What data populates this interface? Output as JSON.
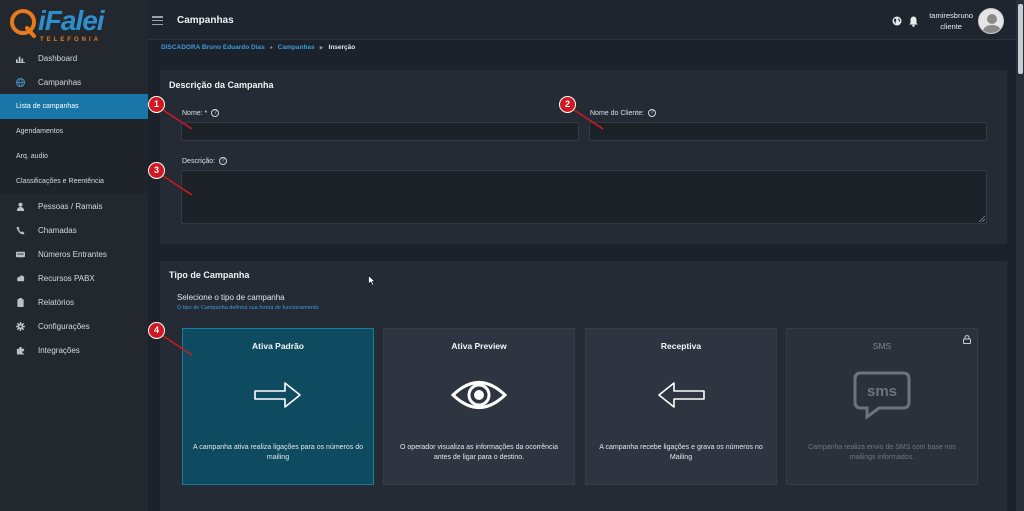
{
  "logo": {
    "name": "iFalei",
    "tagline": "TELEFONIA"
  },
  "sidebar": {
    "items": [
      {
        "label": "Dashboard",
        "icon": "chart-icon"
      },
      {
        "label": "Campanhas",
        "icon": "globe-icon"
      }
    ],
    "subitems": [
      {
        "label": "Lista de campanhas",
        "active": true
      },
      {
        "label": "Agendamentos"
      },
      {
        "label": "Arq. audio"
      },
      {
        "label": "Classificações e Reentência"
      }
    ],
    "more_items": [
      {
        "label": "Pessoas / Ramais",
        "icon": "user-icon"
      },
      {
        "label": "Chamadas",
        "icon": "phone-icon"
      },
      {
        "label": "Números Entrantes",
        "icon": "number-icon"
      },
      {
        "label": "Recursos PABX",
        "icon": "cloud-icon"
      },
      {
        "label": "Relatórios",
        "icon": "clipboard-icon"
      },
      {
        "label": "Configurações",
        "icon": "gear-icon"
      },
      {
        "label": "Integrações",
        "icon": "puzzle-icon"
      }
    ]
  },
  "header": {
    "title": "Campanhas",
    "user": "tamiresbruno",
    "role": "cliente"
  },
  "breadcrumb": [
    "DISCADORA Bruno Eduardo Dias",
    "Campanhas",
    "Inserção"
  ],
  "descricao": {
    "title": "Descrição da Campanha",
    "nome_label": "Nome: *",
    "cliente_label": "Nome do Cliente:",
    "descricao_label": "Descrição:",
    "nome_value": "",
    "cliente_value": "",
    "descricao_value": ""
  },
  "tipo": {
    "title": "Tipo de Campanha",
    "select_label": "Selecione o tipo de campanha",
    "hint": "O tipo de Campanha definirá sua forma de funcionamento",
    "cards": [
      {
        "title": "Ativa Padrão",
        "desc": "A campanha ativa realiza ligações para os números do mailing",
        "icon": "arrow-right-icon",
        "selected": true
      },
      {
        "title": "Ativa Preview",
        "desc": "O operador visualiza as informações da ocorrência antes de ligar para o destino.",
        "icon": "eye-icon"
      },
      {
        "title": "Receptiva",
        "desc": "A campanha recebe ligações e grava os números no Mailing",
        "icon": "arrow-left-icon"
      },
      {
        "title": "SMS",
        "desc": "Campanha realiza envio de SMS com base nos mailings informados.",
        "icon": "sms-icon",
        "locked": true
      }
    ]
  },
  "callouts": [
    "1",
    "2",
    "3",
    "4"
  ],
  "colors": {
    "accent": "#1976a8",
    "link": "#3d9ad6",
    "callout": "#d01820",
    "selected_card": "#0e4a60"
  }
}
